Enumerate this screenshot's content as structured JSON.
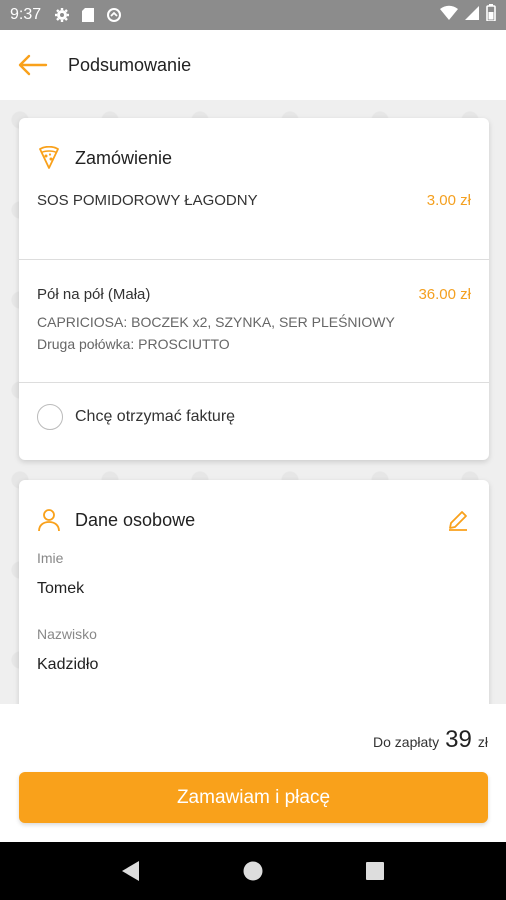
{
  "status_bar": {
    "time": "9:37",
    "icons": [
      "gear-icon",
      "sd-card-icon",
      "data-saver-icon"
    ],
    "right_icons": [
      "wifi-icon",
      "signal-icon",
      "battery-icon"
    ]
  },
  "app_bar": {
    "title": "Podsumowanie",
    "back_icon": "arrow-left-icon"
  },
  "order_card": {
    "title": "Zamówienie",
    "icon": "pizza-slice-icon",
    "items": [
      {
        "name": "SOS POMIDOROWY ŁAGODNY",
        "price": "3.00 zł",
        "description": ""
      },
      {
        "name": "Pół na pół (Mała)",
        "price": "36.00 zł",
        "description_line1": "CAPRICIOSA: BOCZEK x2, SZYNKA, SER PLEŚNIOWY",
        "description_line2": "Druga połówka: PROSCIUTTO"
      }
    ],
    "invoice_label": "Chcę otrzymać fakturę",
    "invoice_checked": false
  },
  "personal_card": {
    "title": "Dane osobowe",
    "icon": "person-icon",
    "edit_icon": "pencil-icon",
    "fields": [
      {
        "label": "Imie",
        "value": "Tomek"
      },
      {
        "label": "Nazwisko",
        "value": "Kadzidło"
      }
    ]
  },
  "summary": {
    "total_label": "Do zapłaty",
    "total_value": "39",
    "currency": "zł",
    "order_button": "Zamawiam i płacę"
  },
  "colors": {
    "accent": "#f9a11b",
    "price": "#f4a020",
    "status_bar": "#8c8c8c"
  }
}
